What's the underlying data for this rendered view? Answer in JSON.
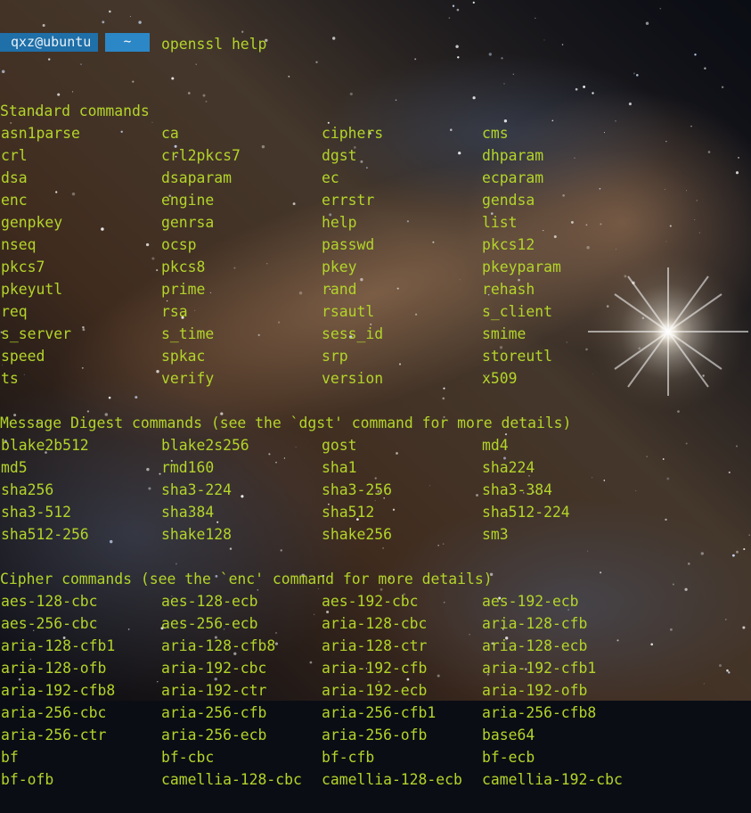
{
  "prompt": {
    "user_host": "qxz@ubuntu",
    "directory": "~",
    "command": "openssl help"
  },
  "sections": [
    {
      "heading": "Standard commands",
      "rows": [
        [
          "asn1parse",
          "ca",
          "ciphers",
          "cms"
        ],
        [
          "crl",
          "crl2pkcs7",
          "dgst",
          "dhparam"
        ],
        [
          "dsa",
          "dsaparam",
          "ec",
          "ecparam"
        ],
        [
          "enc",
          "engine",
          "errstr",
          "gendsa"
        ],
        [
          "genpkey",
          "genrsa",
          "help",
          "list"
        ],
        [
          "nseq",
          "ocsp",
          "passwd",
          "pkcs12"
        ],
        [
          "pkcs7",
          "pkcs8",
          "pkey",
          "pkeyparam"
        ],
        [
          "pkeyutl",
          "prime",
          "rand",
          "rehash"
        ],
        [
          "req",
          "rsa",
          "rsautl",
          "s_client"
        ],
        [
          "s_server",
          "s_time",
          "sess_id",
          "smime"
        ],
        [
          "speed",
          "spkac",
          "srp",
          "storeutl"
        ],
        [
          "ts",
          "verify",
          "version",
          "x509"
        ]
      ]
    },
    {
      "heading": "Message Digest commands (see the `dgst' command for more details)",
      "rows": [
        [
          "blake2b512",
          "blake2s256",
          "gost",
          "md4"
        ],
        [
          "md5",
          "rmd160",
          "sha1",
          "sha224"
        ],
        [
          "sha256",
          "sha3-224",
          "sha3-256",
          "sha3-384"
        ],
        [
          "sha3-512",
          "sha384",
          "sha512",
          "sha512-224"
        ],
        [
          "sha512-256",
          "shake128",
          "shake256",
          "sm3"
        ]
      ]
    },
    {
      "heading": "Cipher commands (see the `enc' command for more details)",
      "rows": [
        [
          "aes-128-cbc",
          "aes-128-ecb",
          "aes-192-cbc",
          "aes-192-ecb"
        ],
        [
          "aes-256-cbc",
          "aes-256-ecb",
          "aria-128-cbc",
          "aria-128-cfb"
        ],
        [
          "aria-128-cfb1",
          "aria-128-cfb8",
          "aria-128-ctr",
          "aria-128-ecb"
        ],
        [
          "aria-128-ofb",
          "aria-192-cbc",
          "aria-192-cfb",
          "aria-192-cfb1"
        ],
        [
          "aria-192-cfb8",
          "aria-192-ctr",
          "aria-192-ecb",
          "aria-192-ofb"
        ],
        [
          "aria-256-cbc",
          "aria-256-cfb",
          "aria-256-cfb1",
          "aria-256-cfb8"
        ],
        [
          "aria-256-ctr",
          "aria-256-ecb",
          "aria-256-ofb",
          "base64"
        ],
        [
          "bf",
          "bf-cbc",
          "bf-cfb",
          "bf-ecb"
        ],
        [
          "bf-ofb",
          "camellia-128-cbc",
          "camellia-128-ecb",
          "camellia-192-cbc"
        ]
      ]
    }
  ],
  "colors": {
    "terminal_text": "#b3d42a",
    "prompt_user_bg": "#1f6fa8",
    "prompt_dir_bg": "#2c87c6"
  }
}
